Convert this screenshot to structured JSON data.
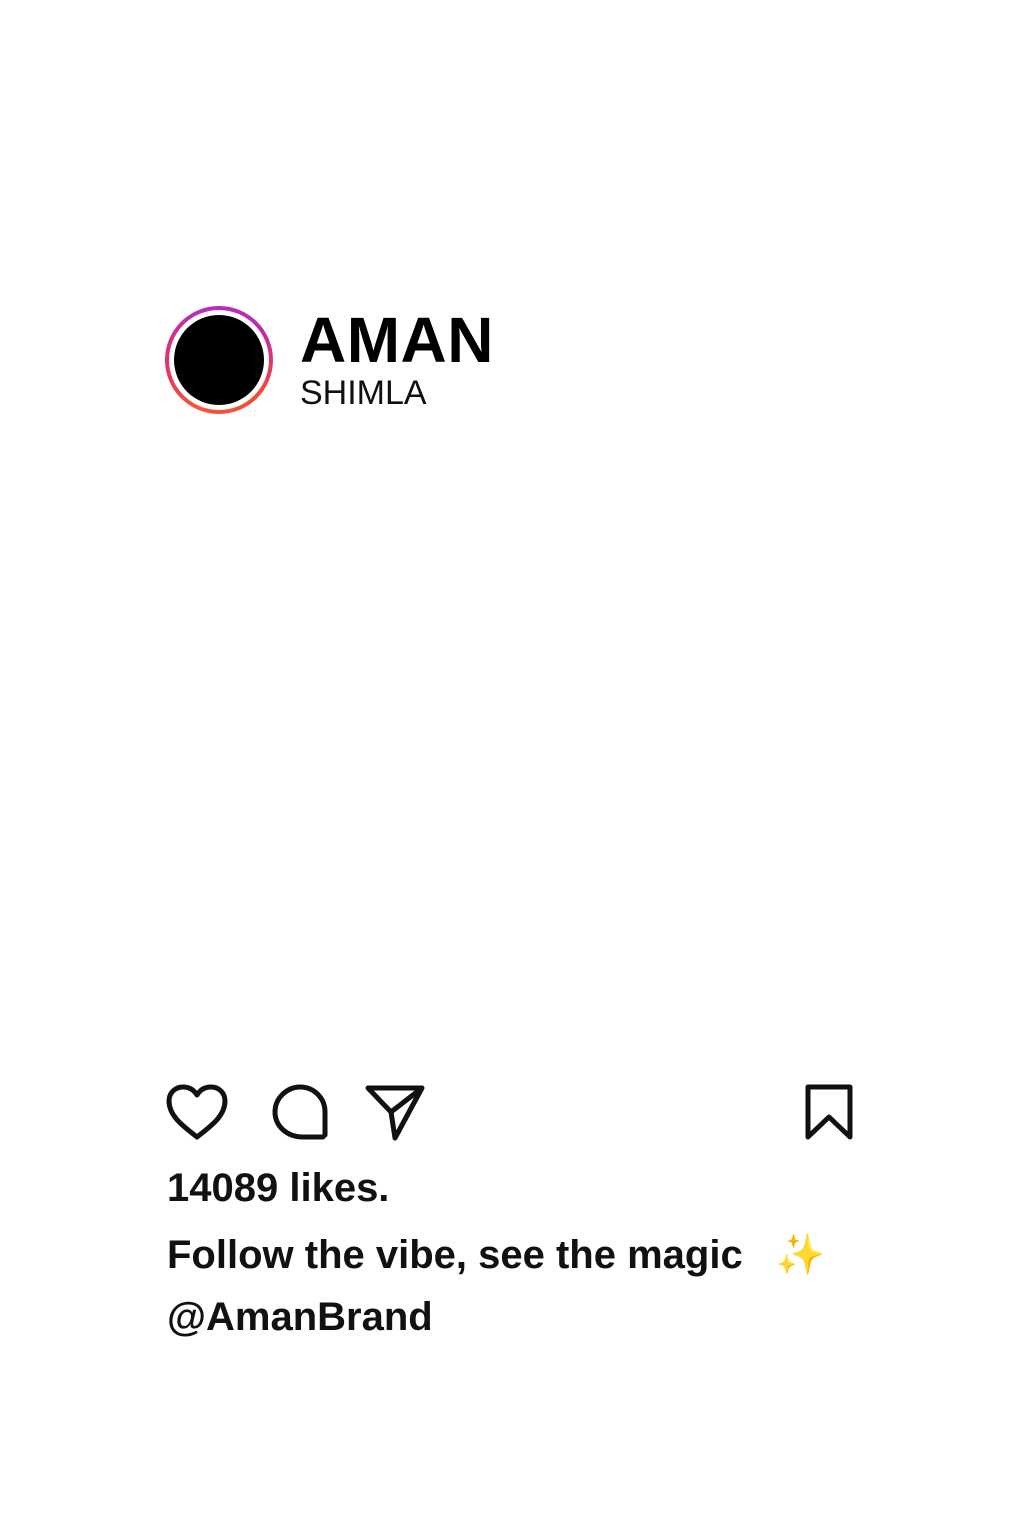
{
  "post": {
    "username": "AMAN",
    "location": "SHIMLA",
    "likes_text": "14089 likes.",
    "caption_text": "Follow the vibe, see the magic",
    "caption_emoji": "✨",
    "handle": "@AmanBrand"
  },
  "actions": {
    "like_icon": "heart-outline-icon",
    "comment_icon": "comment-bubble-icon",
    "share_icon": "paper-plane-icon",
    "save_icon": "bookmark-icon"
  },
  "colors": {
    "text": "#111111",
    "avatar_ring_start": "#b52fbf",
    "avatar_ring_end": "#f9553b",
    "sparkle": "#f5d10a"
  }
}
